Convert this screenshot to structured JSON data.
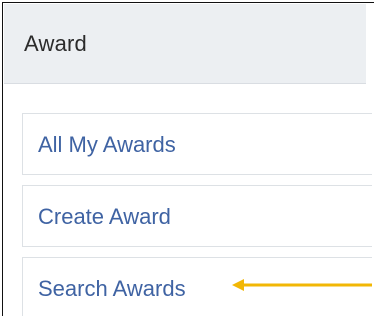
{
  "panel": {
    "title": "Award"
  },
  "nav": {
    "items": [
      {
        "label": "All My Awards"
      },
      {
        "label": "Create Award"
      },
      {
        "label": "Search Awards"
      }
    ]
  },
  "annotation": {
    "icon": "arrow-left-icon",
    "color": "#f2b705"
  }
}
